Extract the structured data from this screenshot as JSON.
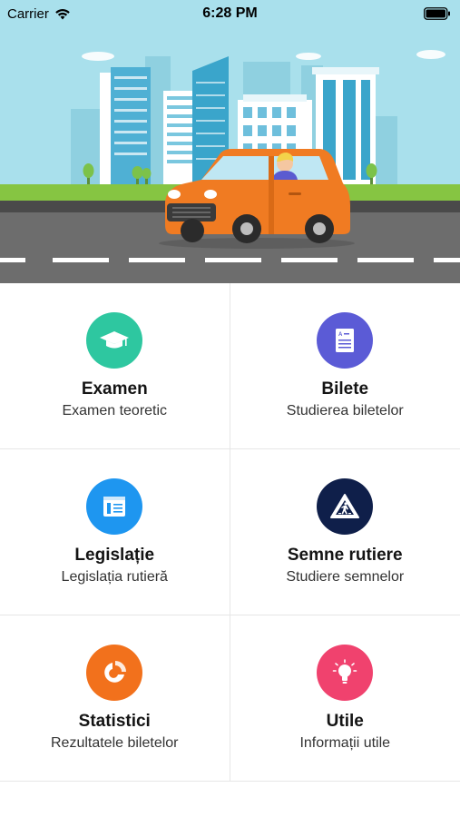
{
  "status_bar": {
    "carrier": "Carrier",
    "time": "6:28 PM"
  },
  "menu": [
    {
      "title": "Examen",
      "subtitle": "Examen teoretic",
      "icon": "graduation-cap-icon",
      "color": "#2ec7a0"
    },
    {
      "title": "Bilete",
      "subtitle": "Studierea biletelor",
      "icon": "document-icon",
      "color": "#5b5bd6"
    },
    {
      "title": "Legislație",
      "subtitle": "Legislația rutieră",
      "icon": "book-icon",
      "color": "#1e96f0"
    },
    {
      "title": "Semne rutiere",
      "subtitle": "Studiere semnelor",
      "icon": "pedestrian-crossing-sign-icon",
      "color": "#0f1f4a"
    },
    {
      "title": "Statistici",
      "subtitle": "Rezultatele biletelor",
      "icon": "pie-chart-icon",
      "color": "#f2711c"
    },
    {
      "title": "Utile",
      "subtitle": "Informații utile",
      "icon": "lightbulb-icon",
      "color": "#f0426e"
    }
  ]
}
